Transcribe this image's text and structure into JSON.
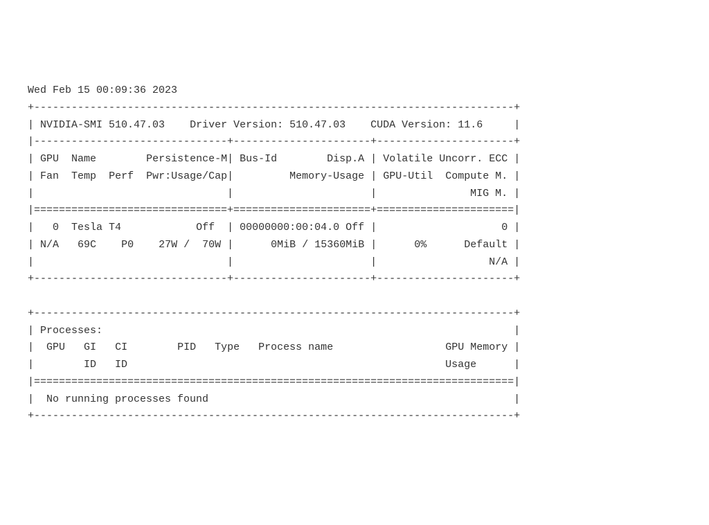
{
  "timestamp": "Wed Feb 15 00:09:36 2023",
  "header": {
    "nvidia_smi_version": "510.47.03",
    "driver_version_label": "Driver Version:",
    "driver_version": "510.47.03",
    "cuda_version_label": "CUDA Version:",
    "cuda_version": "11.6"
  },
  "labels": {
    "gpu": "GPU",
    "name": "Name",
    "persistence_m": "Persistence-M",
    "bus_id": "Bus-Id",
    "disp_a": "Disp.A",
    "volatile_ecc": "Volatile Uncorr. ECC",
    "fan": "Fan",
    "temp": "Temp",
    "perf": "Perf",
    "pwr": "Pwr:Usage/Cap",
    "memory_usage": "Memory-Usage",
    "gpu_util": "GPU-Util",
    "compute_m": "Compute M.",
    "mig_m": "MIG M."
  },
  "gpu": {
    "index": "0",
    "name": "Tesla T4",
    "persistence": "Off",
    "bus_id": "00000000:00:04.0",
    "disp_a": "Off",
    "ecc": "0",
    "fan": "N/A",
    "temp": "69C",
    "perf": "P0",
    "pwr_usage": "27W",
    "pwr_cap": "70W",
    "mem_used": "0MiB",
    "mem_total": "15360MiB",
    "gpu_util": "0%",
    "compute_m": "Default",
    "mig_m": "N/A"
  },
  "processes": {
    "title": "Processes:",
    "cols": {
      "gpu": "GPU",
      "gi": "GI",
      "ci": "CI",
      "id1": "ID",
      "id2": "ID",
      "pid": "PID",
      "type": "Type",
      "process_name": "Process name",
      "gpu_memory": "GPU Memory",
      "usage": "Usage"
    },
    "message": "No running processes found"
  }
}
